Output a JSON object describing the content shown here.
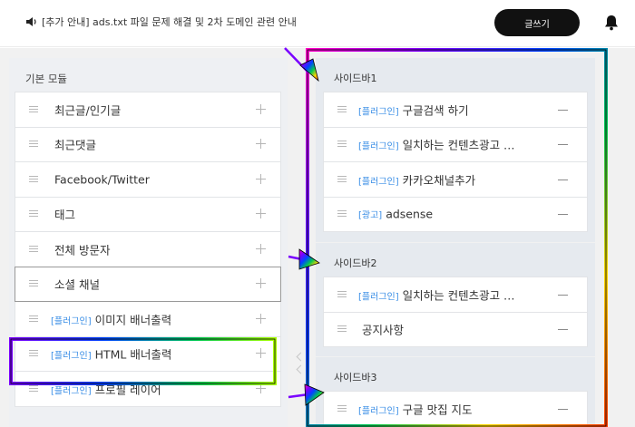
{
  "topbar": {
    "notice": "[추가 안내] ads.txt 파일 문제 해결 및 2차 도메인 관련 안내",
    "write_button": "글쓰기",
    "speaker_icon": "speaker-icon",
    "bell_icon": "bell-icon"
  },
  "left": {
    "title": "기본 모듈",
    "modules": [
      {
        "tag": "",
        "label": "최근글/인기글"
      },
      {
        "tag": "",
        "label": "최근댓글"
      },
      {
        "tag": "",
        "label": "Facebook/Twitter"
      },
      {
        "tag": "",
        "label": "태그"
      },
      {
        "tag": "",
        "label": "전체 방문자"
      },
      {
        "tag": "",
        "label": "소셜 채널"
      },
      {
        "tag": "[플러그인]",
        "label": "이미지 배너출력"
      },
      {
        "tag": "[플러그인]",
        "label": "HTML 배너출력"
      },
      {
        "tag": "[플러그인]",
        "label": "프로필 레이어"
      }
    ]
  },
  "sidebars": [
    {
      "title": "사이드바1",
      "items": [
        {
          "tag": "[플러그인]",
          "label": "구글검색 하기"
        },
        {
          "tag": "[플러그인]",
          "label": "일치하는 컨텐츠광고 …"
        },
        {
          "tag": "[플러그인]",
          "label": "카카오채널추가"
        },
        {
          "tag": "[광고]",
          "label": "adsense"
        }
      ]
    },
    {
      "title": "사이드바2",
      "items": [
        {
          "tag": "[플러그인]",
          "label": "일치하는 컨텐츠광고 …"
        },
        {
          "tag": "",
          "label": "공지사항"
        }
      ]
    },
    {
      "title": "사이드바3",
      "items": [
        {
          "tag": "[플러그인]",
          "label": "구글 맛집 지도"
        }
      ]
    }
  ],
  "colors": {
    "accent_tag": "#3a8ee6",
    "write_button_bg": "#111111",
    "sidebar_bg": "#e6eaef",
    "left_panel_bg": "#eef0f3"
  }
}
